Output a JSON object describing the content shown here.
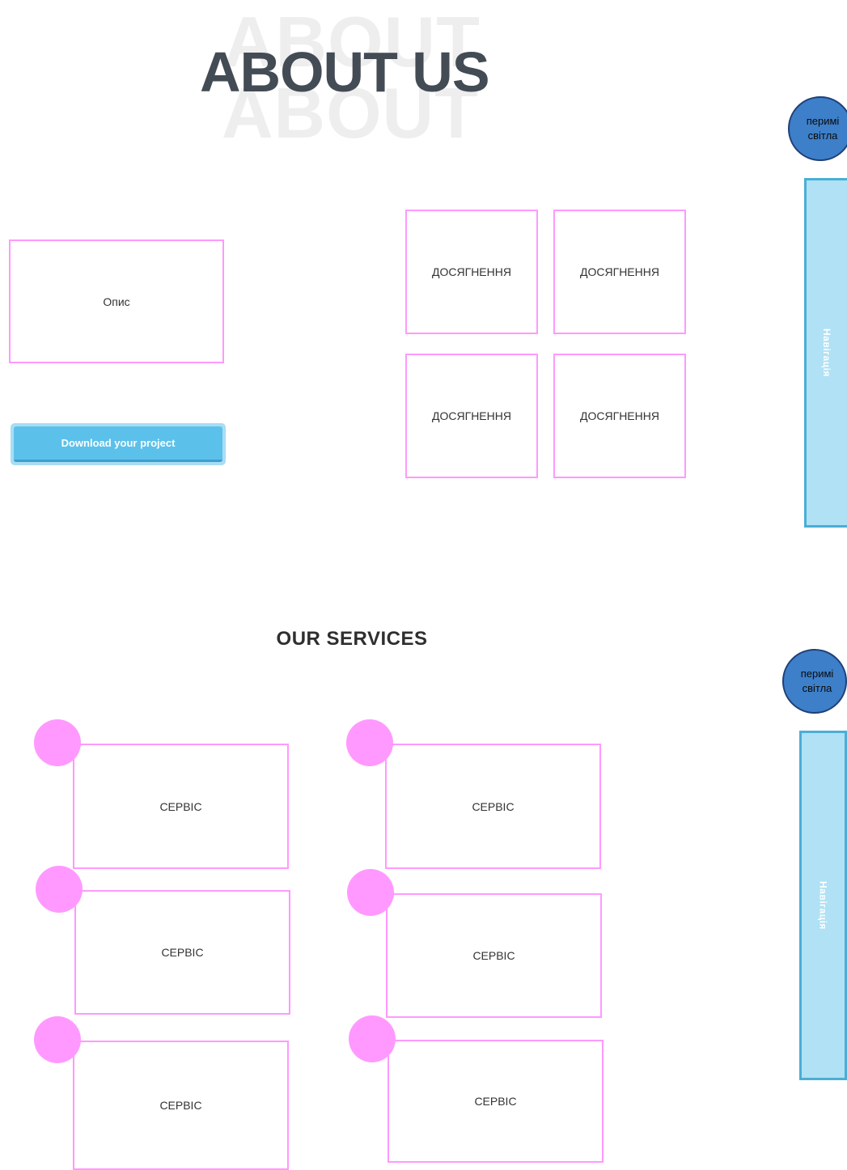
{
  "about": {
    "ghost_top": "ABOUT",
    "ghost_bottom": "ABOUT",
    "title": "ABOUT US",
    "description": "Опис",
    "download_button": "Download your project",
    "achievements": [
      "ДОСЯГНЕННЯ",
      "ДОСЯГНЕННЯ",
      "ДОСЯГНЕННЯ",
      "ДОСЯГНЕННЯ"
    ]
  },
  "theme_toggle": {
    "line1": "перимі",
    "line2": "світла"
  },
  "nav": {
    "label": "Навігація"
  },
  "services": {
    "title": "OUR SERVICES",
    "items": [
      "СЕРВІС",
      "СЕРВІС",
      "СЕРВІС",
      "СЕРВІС",
      "СЕРВІС",
      "СЕРВІС"
    ]
  },
  "colors": {
    "accent_pink": "#ff99ff",
    "button_blue": "#5bc1ea",
    "nav_blue": "#b0e1f4",
    "toggle_blue": "#3d7fc9",
    "title_dark": "#434b55"
  }
}
